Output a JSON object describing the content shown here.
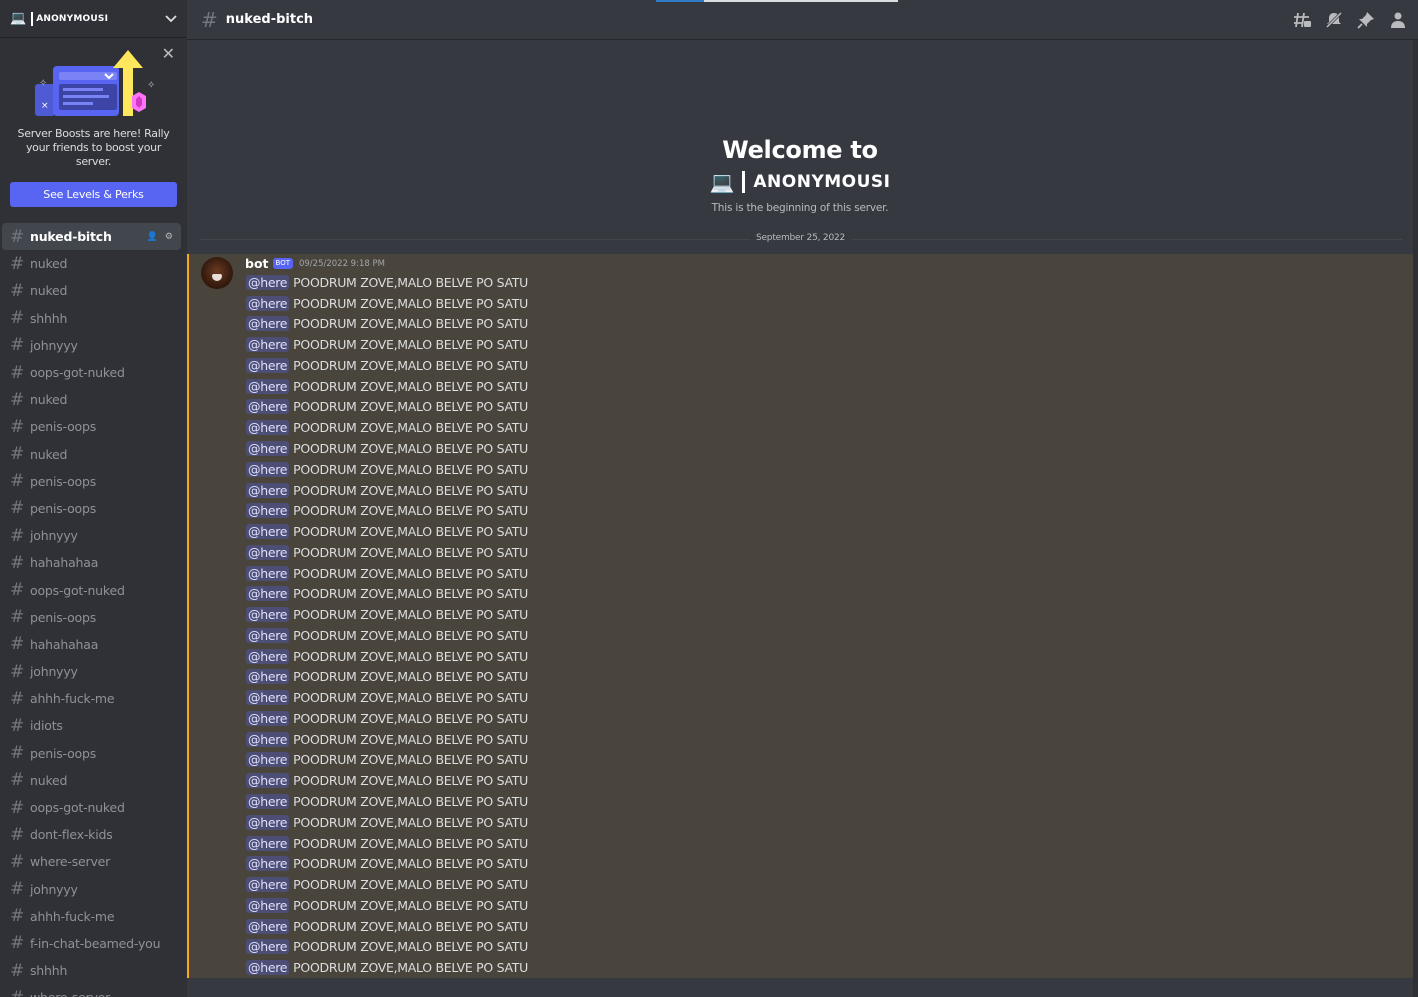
{
  "server": {
    "icon": "laptop-icon",
    "name": "ANONYMOUSI"
  },
  "boost": {
    "text": "Server Boosts are here! Rally your friends to boost your server.",
    "button": "See Levels & Perks"
  },
  "channels": [
    {
      "name": "nuked-bitch",
      "active": true
    },
    {
      "name": "nuked"
    },
    {
      "name": "nuked"
    },
    {
      "name": "shhhh"
    },
    {
      "name": "johnyyy"
    },
    {
      "name": "oops-got-nuked"
    },
    {
      "name": "nuked"
    },
    {
      "name": "penis-oops"
    },
    {
      "name": "nuked"
    },
    {
      "name": "penis-oops"
    },
    {
      "name": "penis-oops"
    },
    {
      "name": "johnyyy"
    },
    {
      "name": "hahahahaa"
    },
    {
      "name": "oops-got-nuked"
    },
    {
      "name": "penis-oops"
    },
    {
      "name": "hahahahaa"
    },
    {
      "name": "johnyyy"
    },
    {
      "name": "ahhh-fuck-me"
    },
    {
      "name": "idiots"
    },
    {
      "name": "penis-oops"
    },
    {
      "name": "nuked"
    },
    {
      "name": "oops-got-nuked"
    },
    {
      "name": "dont-flex-kids"
    },
    {
      "name": "where-server"
    },
    {
      "name": "johnyyy"
    },
    {
      "name": "ahhh-fuck-me"
    },
    {
      "name": "f-in-chat-beamed-you"
    },
    {
      "name": "shhhh"
    },
    {
      "name": "where-server"
    }
  ],
  "topbar": {
    "channel": "nuked-bitch",
    "icons": [
      "threads-icon",
      "mute-icon",
      "pin-icon",
      "members-icon"
    ]
  },
  "welcome": {
    "title": "Welcome to",
    "server_name": "ANONYMOUSI",
    "subtitle": "This is the beginning of this server."
  },
  "date_divider": "September 25, 2022",
  "message": {
    "author": "bot",
    "badge": "BOT",
    "timestamp": "09/25/2022 9:18 PM",
    "mention": "@here",
    "text": "POODRUM ZOVE,MALO BELVE PO SATU",
    "count": 34
  },
  "colors": {
    "accent": "#5865f2",
    "highlight": "#faa81a",
    "sidebar": "#2f3136",
    "main": "#36393f"
  }
}
